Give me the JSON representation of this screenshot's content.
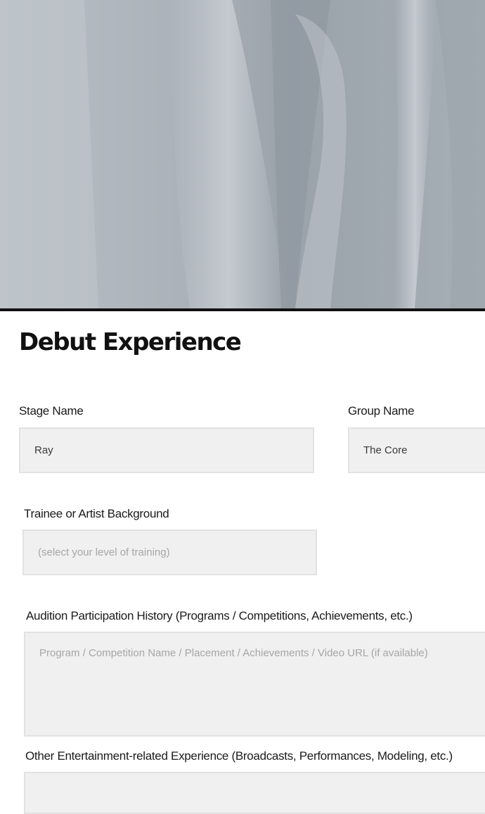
{
  "section": {
    "title": "Debut Experience"
  },
  "fields": {
    "stage_name": {
      "label": "Stage Name",
      "value": "Ray"
    },
    "group_name": {
      "label": "Group Name",
      "value": "The Core"
    },
    "background": {
      "label": "Trainee or Artist Background",
      "selected": "(select your level of training)"
    },
    "audition_history": {
      "label": "Audition Participation History (Programs / Competitions, Achievements, etc.)",
      "placeholder": "Program / Competition Name / Placement / Achievements / Video URL (if available)"
    },
    "other_experience": {
      "label": "Other Entertainment-related Experience (Broadcasts, Performances, Modeling, etc.)"
    }
  },
  "colors": {
    "field_background": "#f0f0f0",
    "field_border": "#e2e2e2",
    "placeholder": "#a6a6a6",
    "title": "#111111"
  }
}
